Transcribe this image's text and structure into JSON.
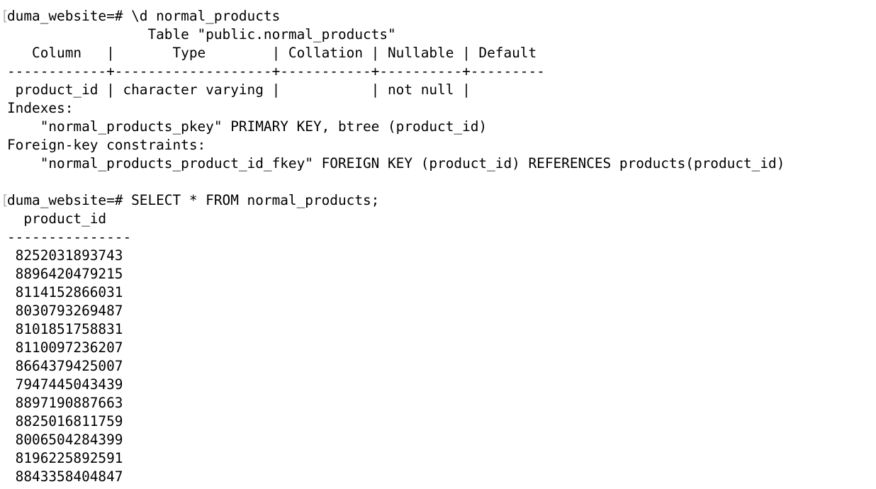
{
  "terminal": {
    "prompt_bracket": "[",
    "describe_block": {
      "command": "duma_website=# \\d normal_products",
      "table_title": "                 Table \"public.normal_products\"",
      "header": "   Column   |       Type        | Collation | Nullable | Default",
      "separator": "------------+-------------------+-----------+----------+---------",
      "row": " product_id | character varying |           | not null |",
      "indexes_heading": "Indexes:",
      "index_entry": "    \"normal_products_pkey\" PRIMARY KEY, btree (product_id)",
      "fk_heading": "Foreign-key constraints:",
      "fk_entry": "    \"normal_products_product_id_fkey\" FOREIGN KEY (product_id) REFERENCES products(product_id)"
    },
    "blank_line": "",
    "select_block": {
      "command": "duma_website=# SELECT * FROM normal_products;",
      "column_header": "  product_id",
      "separator": "---------------",
      "rows": [
        " 8252031893743",
        " 8896420479215",
        " 8114152866031",
        " 8030793269487",
        " 8101851758831",
        " 8110097236207",
        " 8664379425007",
        " 7947445043439",
        " 8897190887663",
        " 8825016811759",
        " 8006504284399",
        " 8196225892591",
        " 8843358404847"
      ]
    }
  }
}
